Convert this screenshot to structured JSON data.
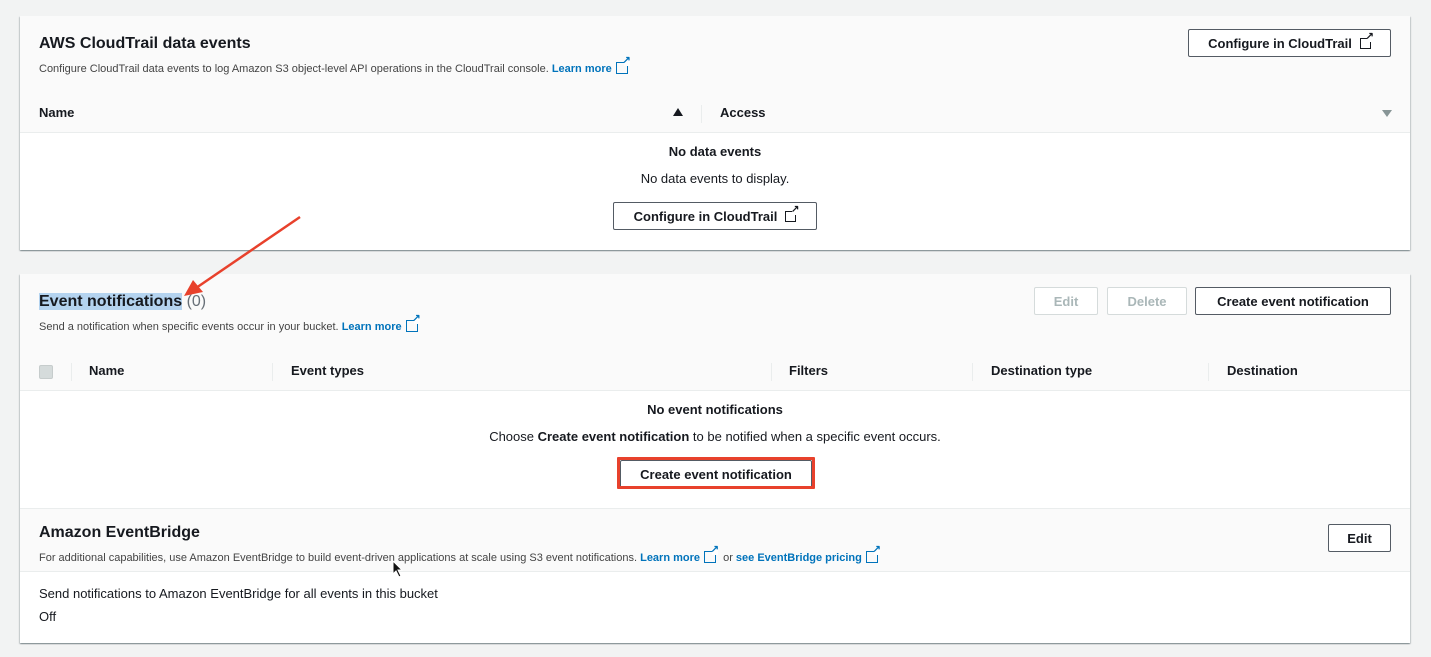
{
  "cloudtrail": {
    "title": "AWS CloudTrail data events",
    "description": "Configure CloudTrail data events to log Amazon S3 object-level API operations in the CloudTrail console.",
    "learn_more": "Learn more",
    "configure_button": "Configure in CloudTrail",
    "columns": [
      "Name",
      "Access"
    ],
    "empty_title": "No data events",
    "empty_text": "No data events to display.",
    "empty_button": "Configure in CloudTrail"
  },
  "event_notifications": {
    "title": "Event notifications",
    "count": "(0)",
    "description": "Send a notification when specific events occur in your bucket.",
    "learn_more": "Learn more",
    "edit_button": "Edit",
    "delete_button": "Delete",
    "create_button": "Create event notification",
    "columns": [
      "Name",
      "Event types",
      "Filters",
      "Destination type",
      "Destination"
    ],
    "empty_title": "No event notifications",
    "empty_text_pre": "Choose ",
    "empty_text_bold": "Create event notification",
    "empty_text_post": " to be notified when a specific event occurs.",
    "empty_button": "Create event notification"
  },
  "eventbridge": {
    "title": "Amazon EventBridge",
    "description": "For additional capabilities, use Amazon EventBridge to build event-driven applications at scale using S3 event notifications.",
    "learn_more": "Learn more",
    "or_text": "or",
    "pricing_link": "see EventBridge pricing",
    "edit_button": "Edit",
    "setting_label": "Send notifications to Amazon EventBridge for all events in this bucket",
    "setting_value": "Off"
  },
  "annotations": {
    "arrow_color": "#e8412c",
    "highlight_color": "#e8412c"
  }
}
